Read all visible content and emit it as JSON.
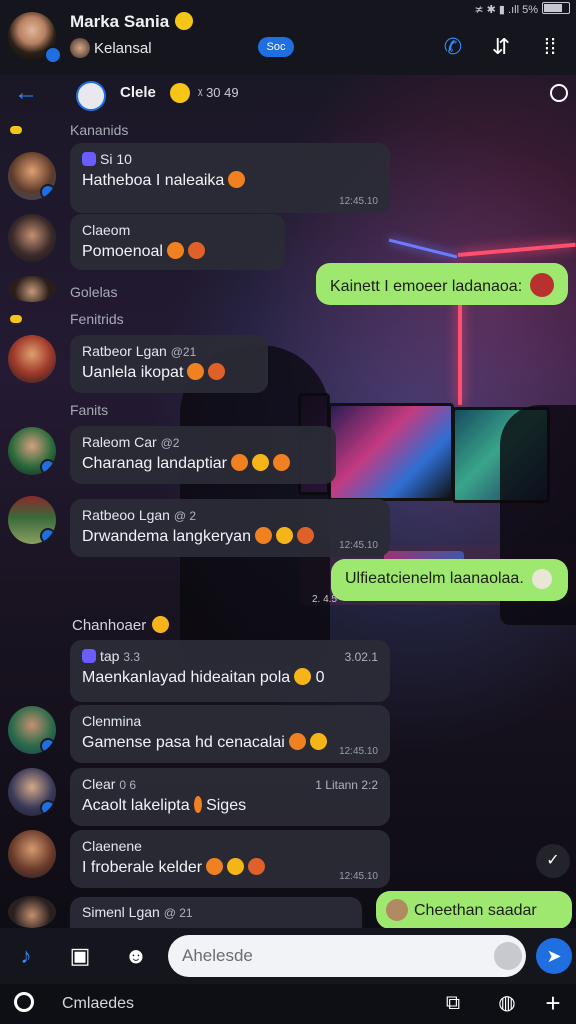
{
  "status": {
    "text": "≭ ✱ ▮ .ıll 5%"
  },
  "header": {
    "name": "Marka Sania",
    "subtitle": "Kelansal",
    "pill": "Soc"
  },
  "subbar": {
    "channel": "Clele",
    "extra": "ᵡ 30 49"
  },
  "sections": {
    "s1": "Kananids",
    "s2": "Golelas",
    "s3": "Fenitrids",
    "s4": "Fanits",
    "s5": "Chanhoaer"
  },
  "messages": [
    {
      "sender": "Si 10",
      "text": "Hatheboa I naleaika",
      "time": "12:45.10"
    },
    {
      "sender": "Claeom",
      "text": "Pomoenoal"
    },
    {
      "sender": "Ratbeor Lgan",
      "meta": "@21",
      "text": "Uanlela ikopat"
    },
    {
      "sender": "Raleom Car",
      "meta": "@2",
      "text": "Charanag landaptiar"
    },
    {
      "sender": "Ratbeoo Lgan",
      "meta": "@ 2",
      "text": "Drwandema langkeryan",
      "time": "12:45.10"
    },
    {
      "sender": "tap",
      "meta": "3.3",
      "right": "3.02.1",
      "text": "Maenkanlayad hideaitan pola",
      "tail": "0"
    },
    {
      "sender": "Clenmina",
      "text": "Gamense pasa hd cenacalai",
      "time": "12:45.10"
    },
    {
      "sender": "Clear",
      "meta": "0 6",
      "right": "1 Litann 2:2",
      "text": "Acaolt lakelipta",
      "tail": "Siges"
    },
    {
      "sender": "Claenene",
      "text": "I froberale kelder",
      "time": "12:45.10"
    },
    {
      "sender": "Simenl Lgan",
      "meta": "@ 21"
    }
  ],
  "outgoing": [
    {
      "text": "Kainett I emoeer ladanaoa:"
    },
    {
      "text": "Ulfieatcienelm laanaolaa."
    },
    {
      "text": "Cheethan saadar"
    }
  ],
  "times": {
    "t1": "2. 4.5"
  },
  "input": {
    "placeholder": "Ahelesde"
  },
  "navbar": {
    "label": "Cmlaedes"
  },
  "colors": {
    "accent": "#1f6fe0",
    "outgoing": "#9fe870",
    "bubble": "#2a2c36"
  }
}
